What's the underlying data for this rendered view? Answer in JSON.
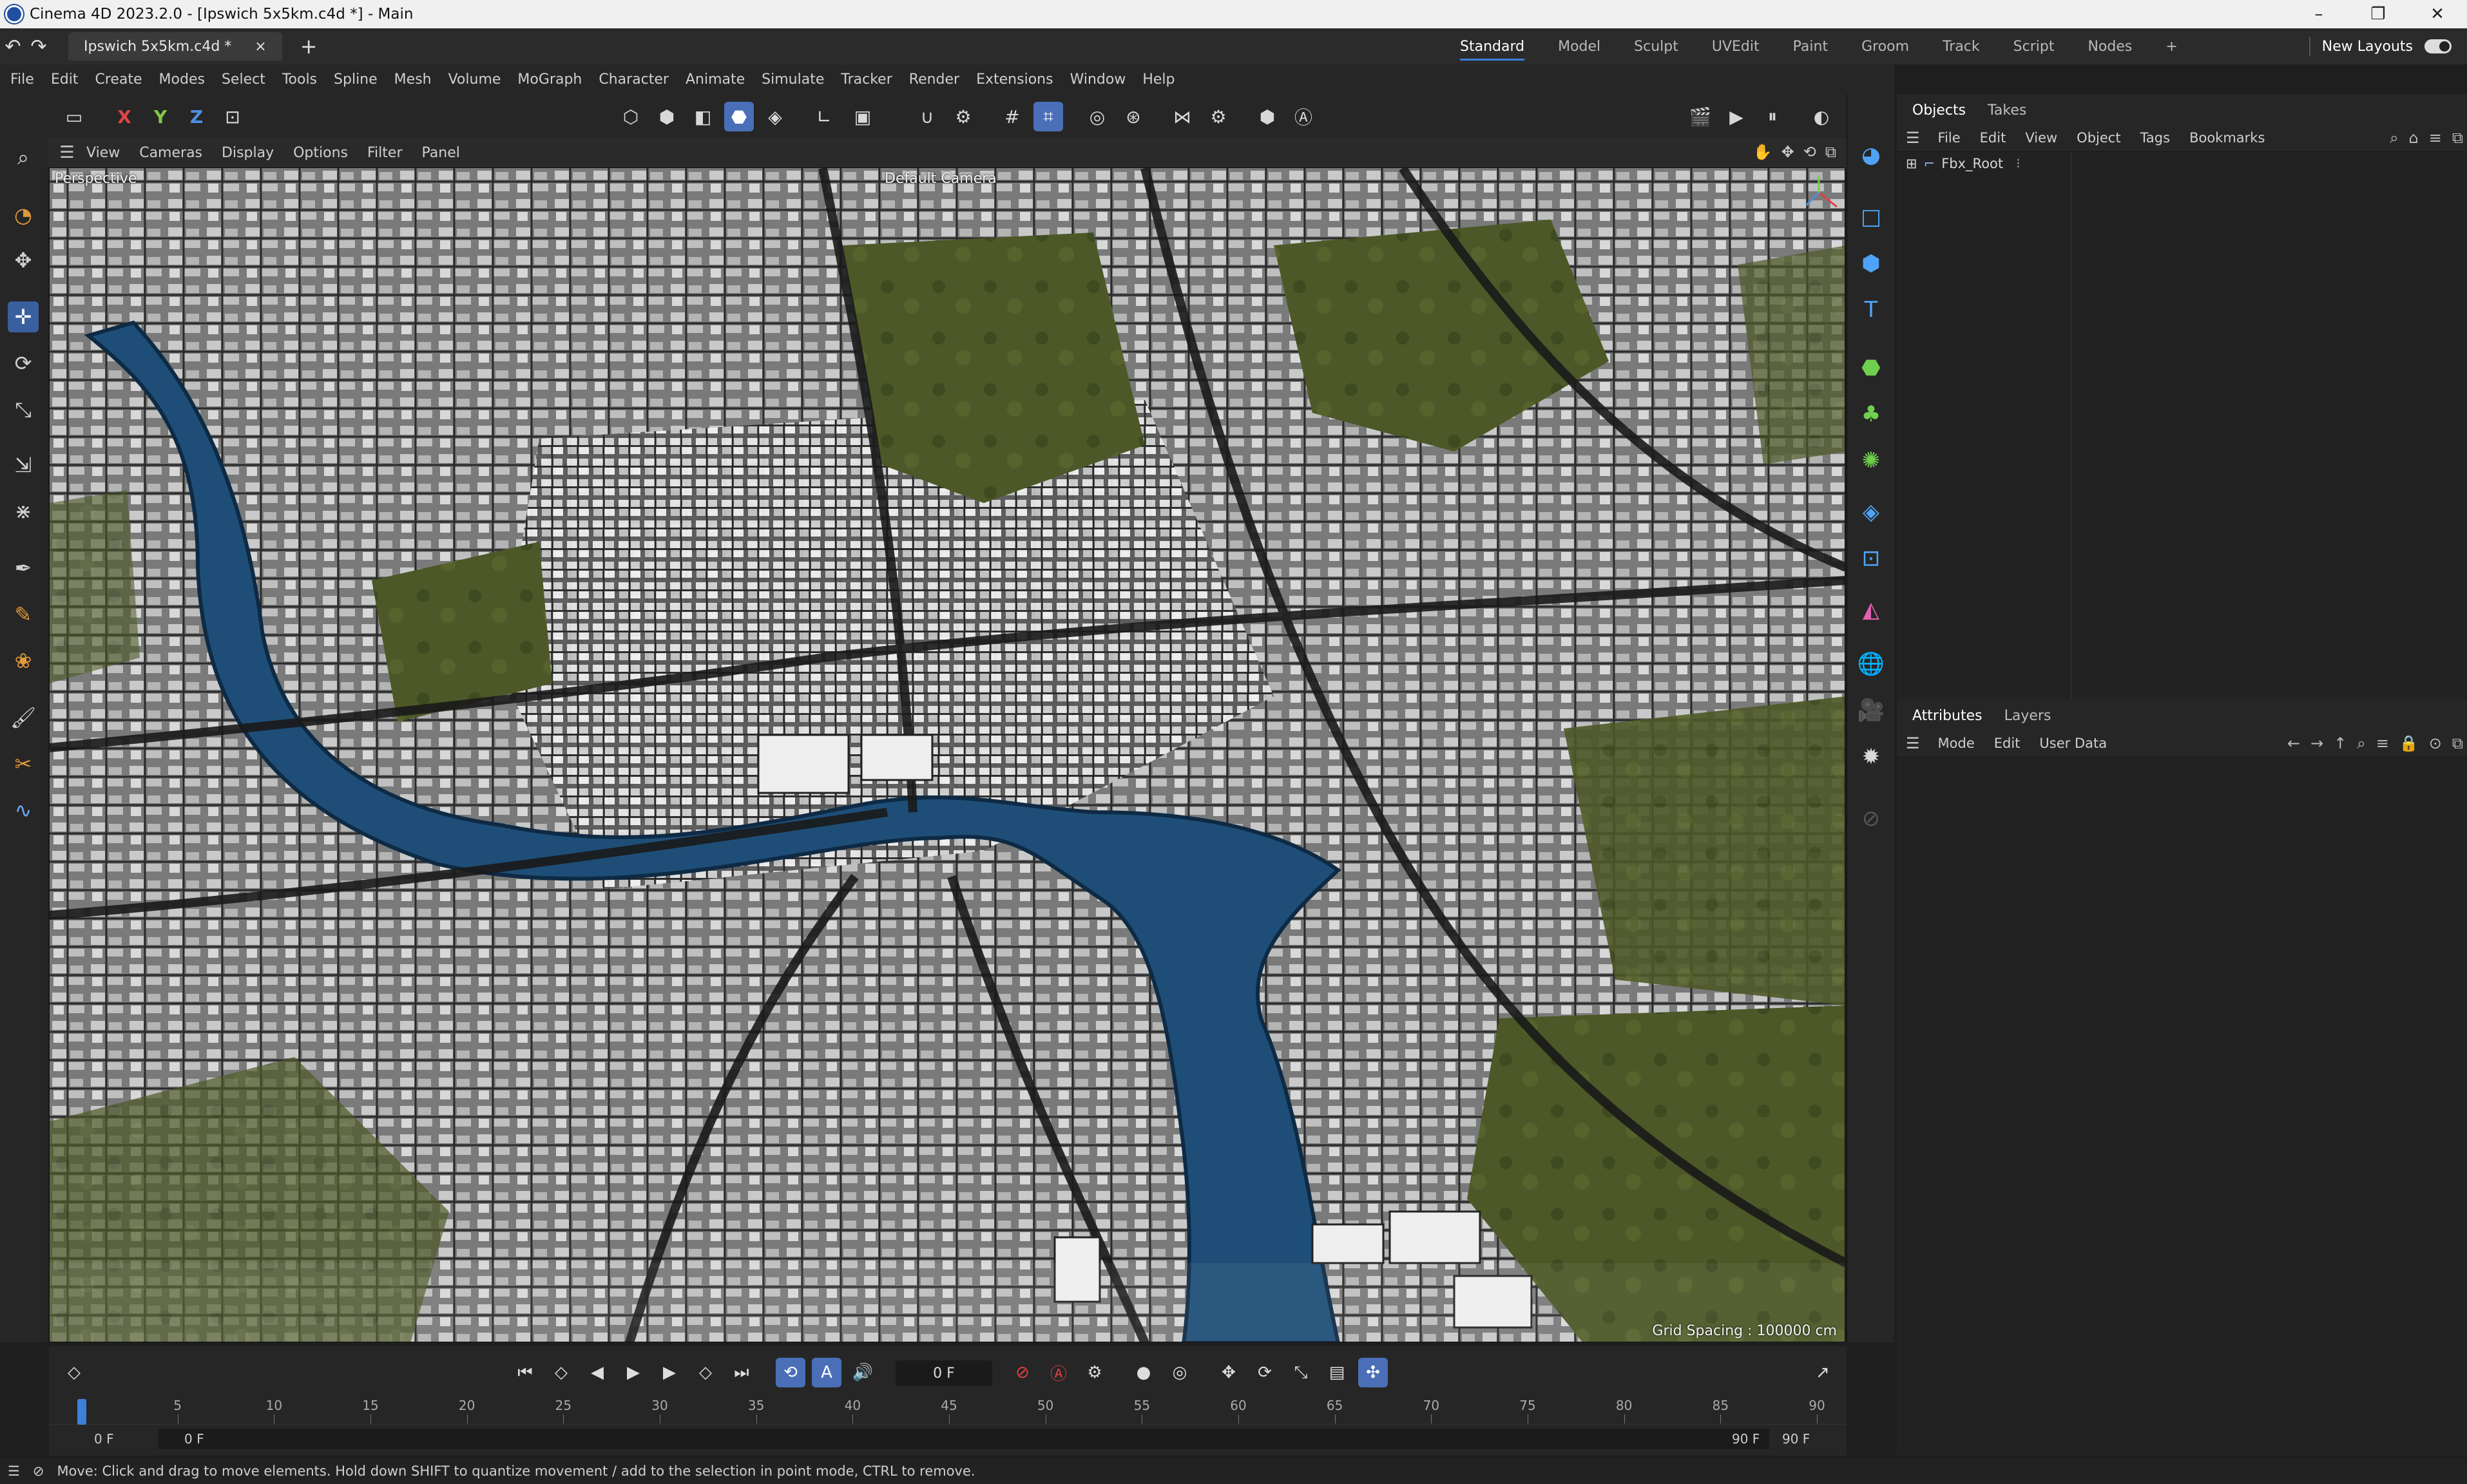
{
  "window": {
    "title": "Cinema 4D 2023.2.0 - [Ipswich 5x5km.c4d *] - Main",
    "controls": [
      "–",
      "❐",
      "✕"
    ]
  },
  "tabs": {
    "document": "Ipswich 5x5km.c4d *",
    "close": "×",
    "add": "+"
  },
  "layouts": {
    "items": [
      "Standard",
      "Model",
      "Sculpt",
      "UVEdit",
      "Paint",
      "Groom",
      "Track",
      "Script",
      "Nodes"
    ],
    "active": "Standard",
    "add": "+",
    "new_layouts": "New Layouts"
  },
  "menubar": [
    "File",
    "Edit",
    "Create",
    "Modes",
    "Select",
    "Tools",
    "Spline",
    "Mesh",
    "Volume",
    "MoGraph",
    "Character",
    "Animate",
    "Simulate",
    "Tracker",
    "Render",
    "Extensions",
    "Window",
    "Help"
  ],
  "toolbar": {
    "axis_x": "X",
    "axis_y": "Y",
    "axis_z": "Z"
  },
  "viewport": {
    "menu": [
      "View",
      "Cameras",
      "Display",
      "Options",
      "Filter",
      "Panel"
    ],
    "projection": "Perspective",
    "camera": "Default Camera",
    "grid_spacing": "Grid Spacing : 100000 cm"
  },
  "objects_panel": {
    "tabs": [
      "Objects",
      "Takes"
    ],
    "menu": [
      "File",
      "Edit",
      "View",
      "Object",
      "Tags",
      "Bookmarks"
    ],
    "objects": [
      {
        "name": "Fbx_Root"
      }
    ]
  },
  "attributes_panel": {
    "tabs": [
      "Attributes",
      "Layers"
    ],
    "menu": [
      "Mode",
      "Edit",
      "User Data"
    ]
  },
  "timeline": {
    "current_frame": "0 F",
    "ruler_ticks": [
      "0",
      "5",
      "10",
      "15",
      "20",
      "25",
      "30",
      "35",
      "40",
      "45",
      "50",
      "55",
      "60",
      "65",
      "70",
      "75",
      "80",
      "85",
      "90"
    ],
    "range_start": "0 F",
    "range_start_inner": "0 F",
    "range_end_inner": "90 F",
    "range_end": "90 F"
  },
  "status": {
    "message": "Move: Click and drag to move elements. Hold down SHIFT to quantize movement / add to the selection in point mode, CTRL to remove."
  },
  "colors": {
    "accent": "#3d7fd9",
    "water": "#1e4e77",
    "park": "#4f5a2a",
    "ground": "#6e6e6e"
  }
}
